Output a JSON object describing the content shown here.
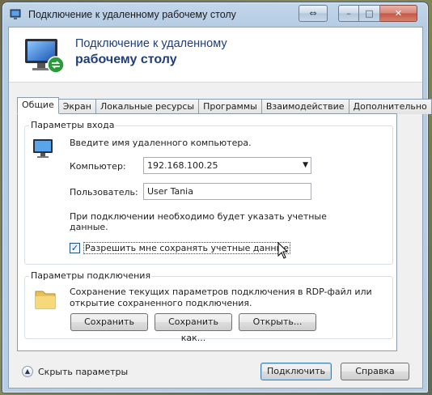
{
  "window": {
    "title": "Подключение к удаленному рабочему столу",
    "buttons": {
      "swap": "⇔",
      "minimize": "–",
      "maximize": "□",
      "close": "✕"
    }
  },
  "header": {
    "line1": "Подключение к удаленному",
    "line2": "рабочему столу"
  },
  "tabs": [
    {
      "label": "Общие",
      "active": true
    },
    {
      "label": "Экран"
    },
    {
      "label": "Локальные ресурсы"
    },
    {
      "label": "Программы"
    },
    {
      "label": "Взаимодействие"
    },
    {
      "label": "Дополнительно"
    }
  ],
  "login": {
    "group_title": "Параметры входа",
    "prompt": "Введите имя удаленного компьютера.",
    "computer_label": "Компьютер:",
    "computer_value": "192.168.100.25",
    "user_label": "Пользователь:",
    "user_value": "User Tania",
    "note": "При подключении необходимо будет указать учетные данные.",
    "note_line1": "При подключении необходимо будет указать учетные",
    "note_line2": "данные.",
    "save_credentials_label": "Разрешить мне сохранять учетные данные",
    "save_credentials_checked": true
  },
  "connection": {
    "group_title": "Параметры подключения",
    "description_line1": "Сохранение текущих параметров подключения в RDP-файл или",
    "description_line2": "открытие сохраненного подключения.",
    "save_button": "Сохранить",
    "save_as_button": "Сохранить как...",
    "open_button": "Открыть..."
  },
  "footer": {
    "hide_options": "Скрыть параметры",
    "connect_button": "Подключить",
    "help_button": "Справка"
  },
  "colors": {
    "header_text": "#1f3e7a",
    "title_bar": "#b5cce3",
    "close_button": "#c45443"
  }
}
